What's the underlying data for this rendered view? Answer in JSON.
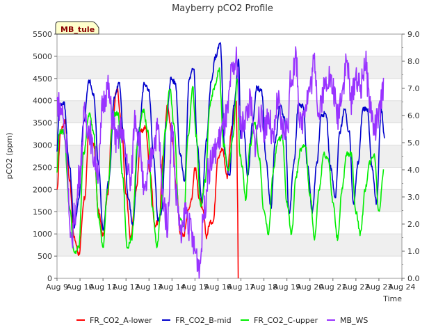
{
  "chart_data": {
    "type": "line",
    "title": "Mayberry pCO2 Profile",
    "tag": "MB_tule",
    "xlabel": "Time",
    "ylabel": "pCO2 (ppm)",
    "xlim": [
      9,
      24
    ],
    "ylim": [
      0,
      5500
    ],
    "y2lim": [
      0,
      9
    ],
    "x_ticks": [
      9,
      10,
      11,
      12,
      13,
      14,
      15,
      16,
      17,
      18,
      19,
      20,
      21,
      22,
      23,
      24
    ],
    "x_tick_labels": [
      "Aug 9",
      "Aug 10",
      "Aug 11",
      "Aug 12",
      "Aug 13",
      "Aug 14",
      "Aug 15",
      "Aug 16",
      "Aug 17",
      "Aug 18",
      "Aug 19",
      "Aug 20",
      "Aug 21",
      "Aug 22",
      "Aug 23",
      "Aug 24"
    ],
    "y_ticks": [
      0,
      500,
      1000,
      1500,
      2000,
      2500,
      3000,
      3500,
      4000,
      4500,
      5000,
      5500
    ],
    "y2_ticks": [
      0.0,
      1.0,
      2.0,
      3.0,
      4.0,
      5.0,
      6.0,
      7.0,
      8.0,
      9.0
    ],
    "y2_tick_labels": [
      "0.0",
      "1.0",
      "2.0",
      "3.0",
      "4.0",
      "5.0",
      "6.0",
      "7.0",
      "8.0",
      "9.0"
    ],
    "grid": "horizontal-bands",
    "legend_placement": "bottom",
    "series": [
      {
        "name": "FR_CO2_A-lower",
        "color": "#ff0000",
        "axis": "left",
        "x": [
          9.0,
          9.15,
          9.35,
          9.55,
          9.75,
          9.95,
          10.2,
          10.4,
          10.6,
          10.8,
          11.0,
          11.2,
          11.4,
          11.6,
          11.8,
          12.0,
          12.2,
          12.45,
          12.65,
          12.85,
          13.05,
          13.25,
          13.45,
          13.6,
          13.8,
          14.0,
          14.2,
          14.35,
          14.5,
          14.7,
          14.85,
          15.0,
          15.2,
          15.35,
          15.5,
          15.65,
          15.8,
          16.0,
          16.2,
          16.4,
          16.6,
          16.8,
          16.85,
          16.88
        ],
        "y": [
          1950,
          3300,
          3550,
          2200,
          900,
          550,
          1800,
          3350,
          3000,
          1500,
          1000,
          1900,
          3500,
          4300,
          3500,
          1900,
          900,
          2000,
          3300,
          3400,
          2400,
          1200,
          1300,
          2700,
          3900,
          3200,
          2000,
          1050,
          950,
          1500,
          1800,
          2500,
          1800,
          1500,
          950,
          1250,
          1300,
          2750,
          2900,
          2300,
          3400,
          4000,
          2000,
          0
        ],
        "step": 0.02
      },
      {
        "name": "FR_CO2_B-mid",
        "color": "#0000cc",
        "axis": "left",
        "x": [
          9.0,
          9.1,
          9.3,
          9.55,
          9.75,
          9.95,
          10.15,
          10.4,
          10.6,
          10.8,
          11.0,
          11.25,
          11.5,
          11.7,
          11.9,
          12.1,
          12.3,
          12.55,
          12.8,
          13.0,
          13.2,
          13.4,
          13.55,
          13.75,
          13.95,
          14.15,
          14.35,
          14.55,
          14.75,
          14.95,
          15.1,
          15.3,
          15.5,
          15.7,
          15.9,
          16.1,
          16.3,
          16.5,
          16.7,
          16.9,
          17.0,
          17.1,
          17.3,
          17.5,
          17.7,
          17.9,
          18.1,
          18.3,
          18.5,
          18.7,
          18.9,
          19.1,
          19.3,
          19.5,
          19.7,
          19.9,
          20.1,
          20.3,
          20.5,
          20.7,
          20.9,
          21.1,
          21.3,
          21.5,
          21.7,
          21.9,
          22.1,
          22.3,
          22.5,
          22.7,
          22.9,
          23.1,
          23.25
        ],
        "y": [
          2900,
          3900,
          3950,
          2500,
          1150,
          1800,
          3500,
          4450,
          4100,
          2600,
          1100,
          2200,
          4100,
          4400,
          3200,
          1800,
          1200,
          3300,
          4400,
          4200,
          2700,
          1300,
          1500,
          3500,
          4500,
          4400,
          2800,
          2200,
          4500,
          4750,
          3000,
          1700,
          3100,
          4400,
          5000,
          5300,
          2800,
          2300,
          3900,
          4900,
          3100,
          3500,
          2300,
          3500,
          4300,
          4200,
          2600,
          1600,
          3100,
          3900,
          3600,
          1400,
          2600,
          3900,
          3900,
          2500,
          1500,
          2600,
          3700,
          3700,
          2500,
          1800,
          3300,
          3800,
          3300,
          1700,
          2600,
          3800,
          3800,
          2500,
          1700,
          3800,
          3200
        ],
        "step": 0.02
      },
      {
        "name": "FR_CO2_C-upper",
        "color": "#00ee00",
        "axis": "left",
        "x": [
          9.0,
          9.1,
          9.3,
          9.55,
          9.75,
          9.95,
          10.15,
          10.4,
          10.6,
          10.8,
          11.0,
          11.2,
          11.45,
          11.65,
          11.85,
          12.05,
          12.25,
          12.5,
          12.75,
          12.95,
          13.15,
          13.35,
          13.5,
          13.7,
          13.9,
          14.1,
          14.3,
          14.5,
          14.7,
          14.9,
          15.05,
          15.25,
          15.45,
          15.65,
          15.85,
          16.05,
          16.25,
          16.45,
          16.65,
          16.85,
          16.95,
          17.05,
          17.2,
          17.4,
          17.6,
          17.8,
          18.0,
          18.2,
          18.4,
          18.6,
          18.8,
          19.0,
          19.2,
          19.4,
          19.6,
          19.8,
          20.0,
          20.2,
          20.4,
          20.6,
          20.8,
          21.0,
          21.2,
          21.4,
          21.6,
          21.8,
          22.0,
          22.2,
          22.4,
          22.6,
          22.8,
          23.0,
          23.2
        ],
        "y": [
          2400,
          3300,
          3300,
          1600,
          550,
          700,
          2800,
          3700,
          3300,
          1400,
          700,
          2000,
          3700,
          3700,
          2300,
          700,
          900,
          3000,
          3800,
          3300,
          1600,
          700,
          1500,
          3300,
          4300,
          3400,
          1400,
          1200,
          3200,
          4300,
          3200,
          1600,
          2200,
          3900,
          4300,
          4700,
          3000,
          2400,
          3200,
          4500,
          2800,
          2500,
          1800,
          3000,
          3500,
          2700,
          1500,
          1000,
          2400,
          3100,
          3200,
          1700,
          1000,
          2300,
          2900,
          3000,
          1900,
          900,
          2000,
          2800,
          2700,
          1700,
          900,
          2000,
          2800,
          2800,
          1500,
          1000,
          2000,
          2600,
          2800,
          1500,
          2400
        ],
        "step": 0.02
      },
      {
        "name": "MB_WS",
        "color": "#9933ff",
        "axis": "right",
        "x": [
          9.0,
          9.2,
          9.4,
          9.6,
          9.8,
          10.0,
          10.2,
          10.4,
          10.6,
          10.8,
          11.0,
          11.2,
          11.4,
          11.6,
          11.8,
          12.0,
          12.2,
          12.4,
          12.6,
          12.8,
          13.0,
          13.2,
          13.4,
          13.6,
          13.8,
          14.0,
          14.2,
          14.4,
          14.6,
          14.8,
          15.0,
          15.2,
          15.4,
          15.6,
          15.8,
          16.0,
          16.2,
          16.4,
          16.6,
          16.8,
          17.0,
          17.2,
          17.4,
          17.6,
          17.8,
          18.0,
          18.2,
          18.4,
          18.6,
          18.8,
          19.0,
          19.2,
          19.4,
          19.6,
          19.8,
          20.0,
          20.2,
          20.4,
          20.6,
          20.8,
          21.0,
          21.2,
          21.4,
          21.6,
          21.8,
          22.0,
          22.2,
          22.4,
          22.6,
          22.8,
          23.0,
          23.2
        ],
        "y": [
          6.5,
          6.2,
          5.0,
          1.2,
          2.5,
          4.0,
          6.0,
          5.5,
          4.5,
          4.0,
          6.5,
          7.0,
          6.0,
          5.0,
          5.5,
          4.5,
          3.5,
          6.0,
          5.0,
          3.0,
          4.0,
          5.0,
          5.5,
          3.0,
          2.0,
          5.5,
          3.0,
          1.5,
          2.5,
          1.8,
          1.0,
          0.5,
          2.5,
          4.0,
          4.5,
          5.0,
          5.5,
          6.0,
          7.5,
          8.0,
          5.5,
          6.0,
          6.5,
          5.0,
          6.0,
          5.5,
          6.0,
          5.0,
          6.5,
          5.5,
          5.5,
          7.5,
          8.0,
          5.5,
          6.5,
          7.0,
          8.0,
          6.0,
          7.0,
          7.5,
          7.0,
          6.0,
          7.0,
          8.0,
          6.5,
          7.5,
          7.0,
          8.0,
          6.5,
          5.5,
          6.0,
          7.0
        ],
        "step": 0.02
      }
    ]
  }
}
